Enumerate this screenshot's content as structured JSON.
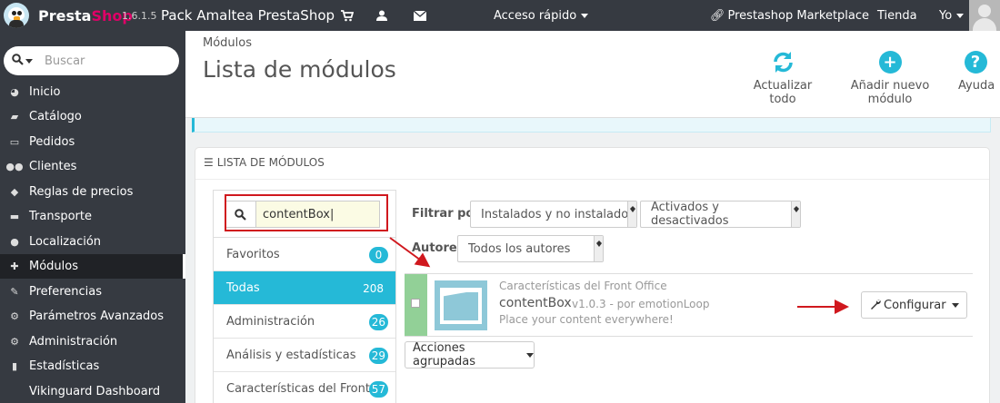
{
  "topbar": {
    "brand_a": "Presta",
    "brand_b": "Shop",
    "version": "1.6.1.5",
    "shop_name": "Pack Amaltea PrestaShop",
    "quick_access": "Acceso rápido",
    "marketplace": "Prestashop Marketplace",
    "store": "Tienda",
    "user": "Yo",
    "accent_color": "#df0067"
  },
  "sidebar": {
    "search_placeholder": "Buscar",
    "items": [
      {
        "label": "Inicio",
        "icon": "dashboard-icon"
      },
      {
        "label": "Catálogo",
        "icon": "book-icon"
      },
      {
        "label": "Pedidos",
        "icon": "credit-card-icon"
      },
      {
        "label": "Clientes",
        "icon": "users-icon"
      },
      {
        "label": "Reglas de precios",
        "icon": "tags-icon"
      },
      {
        "label": "Transporte",
        "icon": "truck-icon"
      },
      {
        "label": "Localización",
        "icon": "globe-icon"
      },
      {
        "label": "Módulos",
        "icon": "puzzle-icon"
      },
      {
        "label": "Preferencias",
        "icon": "wrench-icon"
      },
      {
        "label": "Parámetros Avanzados",
        "icon": "cogs-icon"
      },
      {
        "label": "Administración",
        "icon": "cog-icon"
      },
      {
        "label": "Estadísticas",
        "icon": "bar-chart-icon"
      },
      {
        "label": "Vikinguard Dashboard",
        "icon": ""
      }
    ]
  },
  "header": {
    "breadcrumb": "Módulos",
    "title": "Lista de módulos",
    "tools": {
      "refresh": "Actualizar todo",
      "add": "Añadir nuevo módulo",
      "help": "Ayuda"
    },
    "accent_color": "#25b9d7"
  },
  "panel": {
    "heading": "LISTA DE MÓDULOS",
    "search_value": "contentBox",
    "categories": [
      {
        "label": "Favoritos",
        "count": "0"
      },
      {
        "label": "Todas",
        "count": "208"
      },
      {
        "label": "Administración",
        "count": "26"
      },
      {
        "label": "Análisis y estadísticas",
        "count": "29"
      },
      {
        "label": "Características del Front...",
        "count": "57"
      }
    ],
    "filter_label": "Filtrar por",
    "filter_install": "Instalados y no instalados",
    "filter_active": "Activados y desactivados",
    "authors_label": "Autores",
    "authors_value": "Todos los autores",
    "module": {
      "category": "Características del Front Office",
      "name": "contentBox",
      "version": "v1.0.3 - por emotionLoop",
      "description": "Place your content everywhere!",
      "configure": "Configurar"
    },
    "bulk_actions": "Acciones agrupadas"
  }
}
